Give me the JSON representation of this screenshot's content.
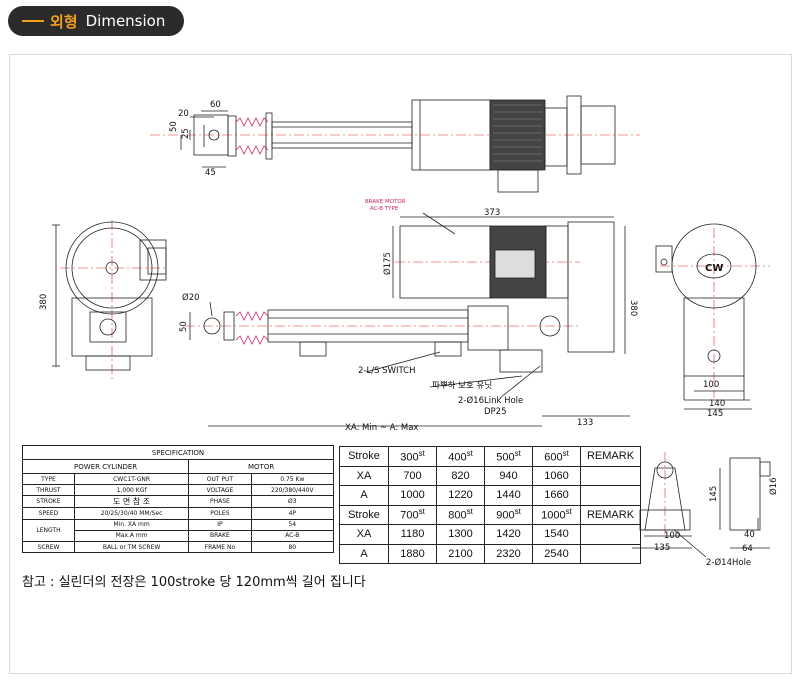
{
  "header": {
    "title_kr": "외형",
    "title_en": "Dimension"
  },
  "colors": {
    "accent": "#f2a11f",
    "pill": "#2b2b2b",
    "centerline": "#e03030",
    "spring": "#cc2266",
    "brake_label": "#cc2266"
  },
  "dims": {
    "top_60": "60",
    "top_20": "20",
    "top_50": "50",
    "top_25": "25",
    "top_45": "45",
    "side_380": "380",
    "motor_373": "373",
    "motor_175": "Ø175",
    "main_380": "380",
    "rod_20": "Ø20",
    "rod_50": "50",
    "xa": "XA: Min ~ A: Max",
    "d133": "133",
    "f100": "100",
    "f140": "140",
    "f145": "145",
    "b16": "Ø16",
    "b145": "145",
    "b40": "40",
    "b64": "64",
    "b100": "100",
    "b135": "135",
    "b_hole": "2-Ø14Hole"
  },
  "labels": {
    "brake_motor": "BRAKE MOTOR",
    "brake_type": "AC-B TYPE",
    "switch": "2-L/S SWITCH",
    "pipe": "파뿌하 보호 유닛",
    "link_hole": "2-Ø16Link Hole",
    "dp": "DP25",
    "cw": "CW"
  },
  "spec": {
    "title": "SPECIFICATION",
    "col_left": "POWER CYLINDER",
    "col_right": "MOTOR",
    "rows": [
      {
        "k": "TYPE",
        "v": "CWC1T-GNR",
        "mk": "OUT PUT",
        "mv": "0.75 Kw"
      },
      {
        "k": "THRUST",
        "v": "1,000 KGf",
        "mk": "VOLTAGE",
        "mv": "220/380/440V"
      },
      {
        "k": "STROKE",
        "v": "도 면 참 조",
        "mk": "PHASE",
        "mv": "Ø3"
      },
      {
        "k": "SPEED",
        "v": "20/25/30/40 MM/Sec",
        "mk": "POLES",
        "mv": "4P"
      },
      {
        "k": "LENGTH",
        "v": "Min. XA mm",
        "mk": "IP",
        "mv": "54"
      },
      {
        "k": "",
        "v": "Max.A mm",
        "mk": "BRAKE",
        "mv": "AC-B"
      },
      {
        "k": "SCREW",
        "v": "BALL or TM SCREW",
        "mk": "FRAME No",
        "mv": "80"
      }
    ]
  },
  "stroke_table_1": {
    "header": "Stroke",
    "remark": "REMARK",
    "st": "st",
    "cols": [
      "300",
      "400",
      "500",
      "600"
    ],
    "xa_label": "XA",
    "a_label": "A",
    "xa": [
      "700",
      "820",
      "940",
      "1060"
    ],
    "a": [
      "1000",
      "1220",
      "1440",
      "1660"
    ]
  },
  "stroke_table_2": {
    "header": "Stroke",
    "remark": "REMARK",
    "st": "st",
    "cols": [
      "700",
      "800",
      "900",
      "1000"
    ],
    "xa_label": "XA",
    "a_label": "A",
    "xa": [
      "1180",
      "1300",
      "1420",
      "1540"
    ],
    "a": [
      "1880",
      "2100",
      "2320",
      "2540"
    ]
  },
  "note": "참고 : 실린더의 전장은 100stroke 당 120mm씩 길어 집니다"
}
